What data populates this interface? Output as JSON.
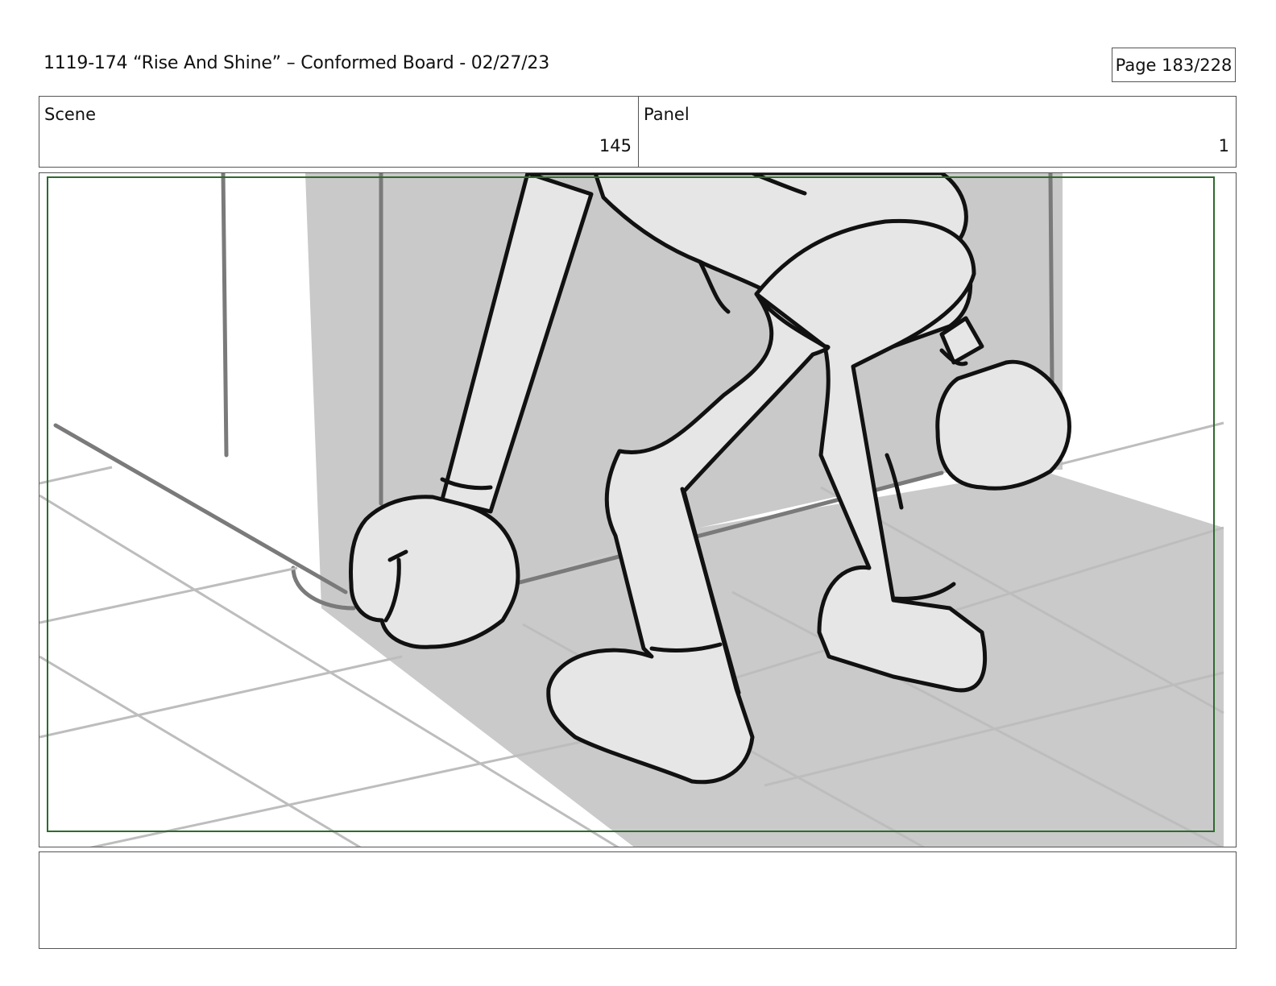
{
  "header": {
    "title": "1119-174 “Rise And Shine” – Conformed Board - 02/27/23",
    "page": "Page 183/228"
  },
  "info": {
    "scene_label": "Scene",
    "scene_value": "145",
    "panel_label": "Panel",
    "panel_value": "1"
  },
  "frame": {
    "safe_area_color": "#2e6b2e",
    "shadow_color": "#cacaca",
    "character_fill": "#e6e6e6",
    "wall_shade_color": "#c9c9c9"
  },
  "notes": {
    "text": ""
  }
}
